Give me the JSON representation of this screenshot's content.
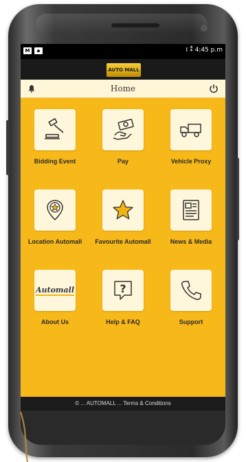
{
  "statusbar": {
    "left_icons": [
      "M",
      "▪"
    ],
    "right_text": "🕻 ⁑ 4:45 p.m"
  },
  "logo": {
    "text": "AUTO MALL"
  },
  "header": {
    "title": "Home"
  },
  "tiles": [
    {
      "label": "Bidding Event",
      "icon": "gavel-icon"
    },
    {
      "label": "Pay",
      "icon": "money-hand-icon"
    },
    {
      "label": "Vehicle Proxy",
      "icon": "truck-icon"
    },
    {
      "label": "Location Automall",
      "icon": "location-star-icon"
    },
    {
      "label": "Favourite Automall",
      "icon": "star-icon"
    },
    {
      "label": "News & Media",
      "icon": "newspaper-icon"
    },
    {
      "label": "About Us",
      "icon": "automall-logo-icon"
    },
    {
      "label": "Help & FAQ",
      "icon": "question-bubble-icon"
    },
    {
      "label": "Support",
      "icon": "phone-icon"
    }
  ],
  "about_logo_text": "Automall",
  "footer": {
    "text": "© ... AUTOMALL ... Terms & Conditions"
  },
  "colors": {
    "background": "#f7b81a",
    "tile": "#fff7dc",
    "dark": "#1b1b1b"
  }
}
